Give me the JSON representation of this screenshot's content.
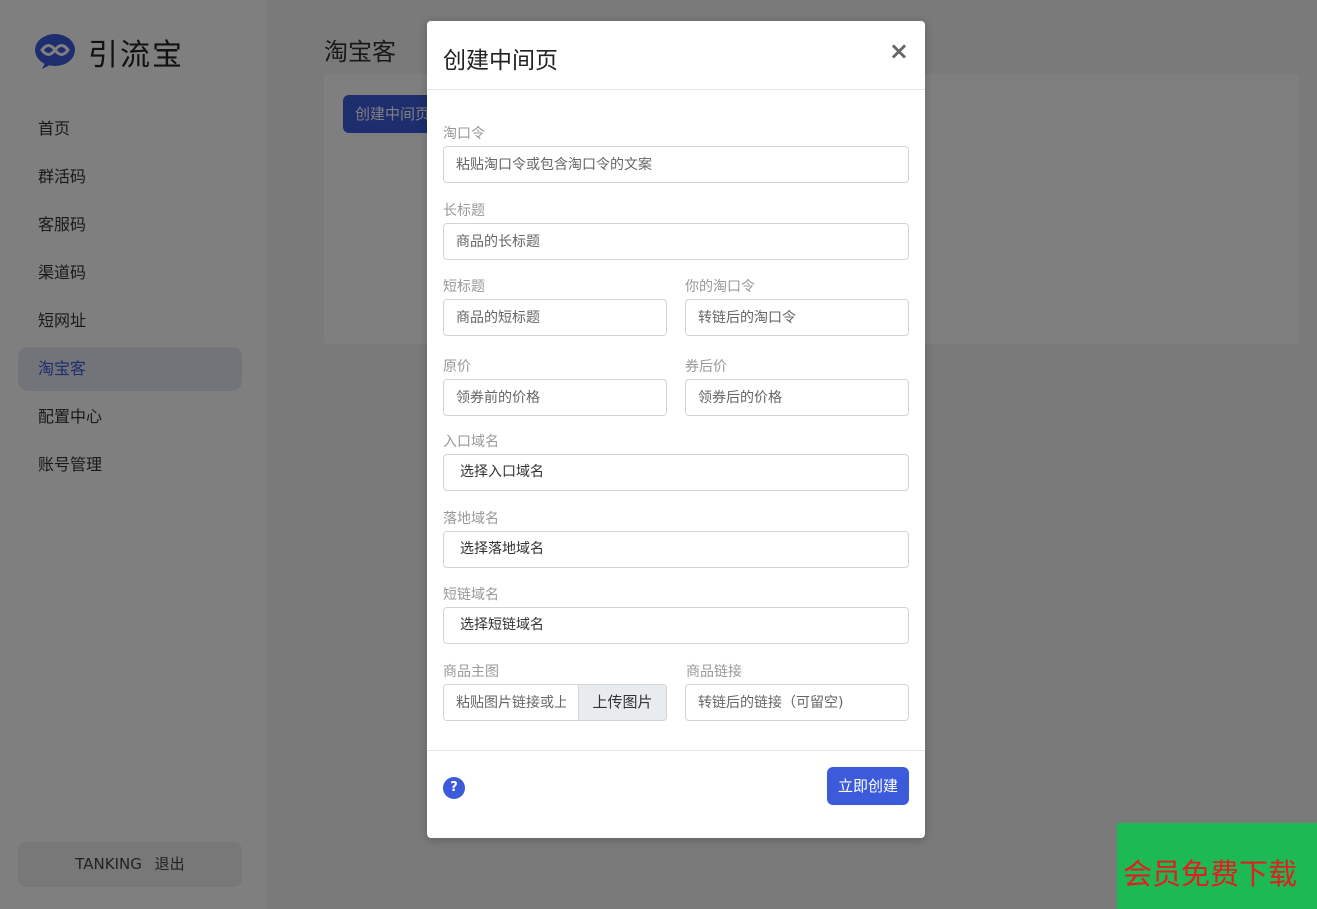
{
  "sidebar": {
    "brand": "引流宝",
    "items": [
      {
        "label": "首页"
      },
      {
        "label": "群活码"
      },
      {
        "label": "客服码"
      },
      {
        "label": "渠道码"
      },
      {
        "label": "短网址"
      },
      {
        "label": "淘宝客"
      },
      {
        "label": "配置中心"
      },
      {
        "label": "账号管理"
      }
    ],
    "active_index": 5,
    "user": {
      "name": "TANKING",
      "logout": "退出"
    }
  },
  "main": {
    "title": "淘宝客",
    "create_button": "创建中间页"
  },
  "modal": {
    "title": "创建中间页",
    "close": "×",
    "fields": {
      "tkl": {
        "label": "淘口令",
        "placeholder": "粘贴淘口令或包含淘口令的文案"
      },
      "long_title": {
        "label": "长标题",
        "placeholder": "商品的长标题"
      },
      "short_title": {
        "label": "短标题",
        "placeholder": "商品的短标题"
      },
      "your_tkl": {
        "label": "你的淘口令",
        "placeholder": "转链后的淘口令"
      },
      "original_price": {
        "label": "原价",
        "placeholder": "领券前的价格"
      },
      "coupon_price": {
        "label": "券后价",
        "placeholder": "领券后的价格"
      },
      "entry_domain": {
        "label": "入口域名",
        "value": "选择入口域名"
      },
      "landing_domain": {
        "label": "落地域名",
        "value": "选择落地域名"
      },
      "short_domain": {
        "label": "短链域名",
        "value": "选择短链域名"
      },
      "main_image": {
        "label": "商品主图",
        "placeholder": "粘贴图片链接或上传",
        "upload": "上传图片"
      },
      "product_link": {
        "label": "商品链接",
        "placeholder": "转链后的链接（可留空)"
      }
    },
    "help": "?",
    "submit": "立即创建"
  },
  "badge": {
    "text": "会员免费下载"
  },
  "colors": {
    "accent": "#3b5bdb",
    "badge_bg": "#1db954",
    "badge_text": "#e02020"
  }
}
